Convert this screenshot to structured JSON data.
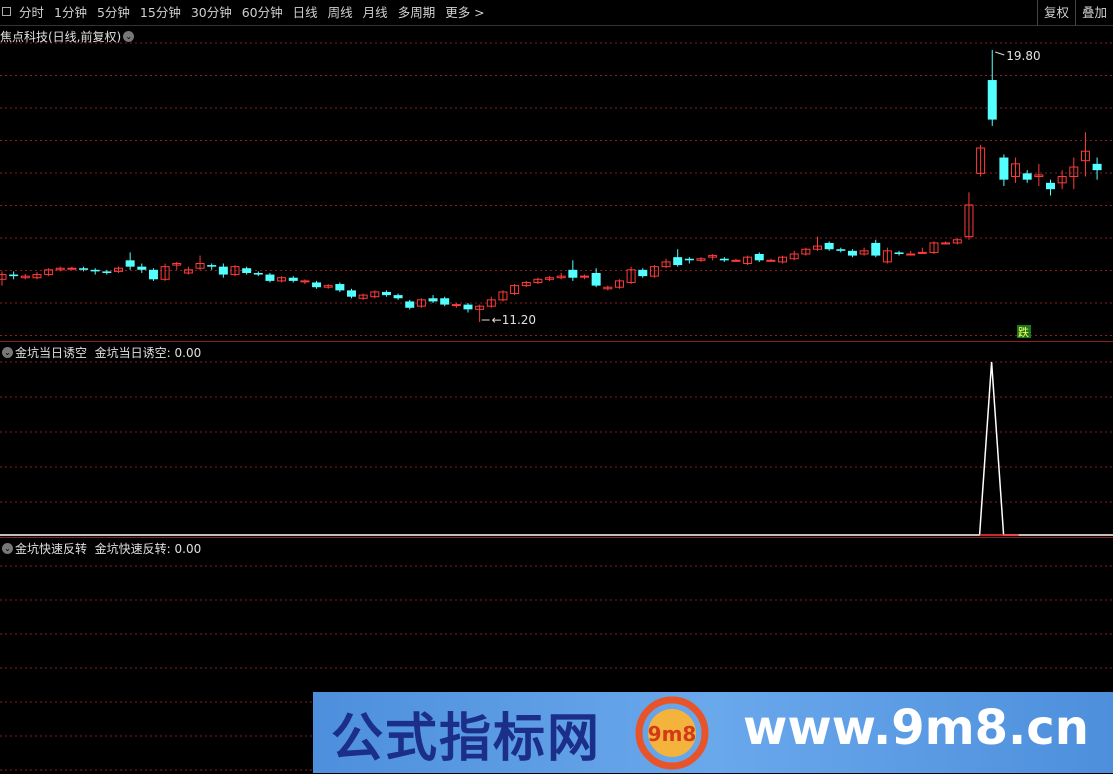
{
  "toolbar": {
    "period_tabs": [
      "分时",
      "1分钟",
      "5分钟",
      "15分钟",
      "30分钟",
      "60分钟",
      "日线",
      "周线",
      "月线",
      "多周期",
      "更多 >"
    ],
    "restore_label": "复权",
    "overlay_label": "叠加"
  },
  "main_chart": {
    "title": "焦点科技(日线,前复权)",
    "high_label": "19.80",
    "low_label": "11.20",
    "badge": "跌",
    "colors": {
      "up": "#ff3b3b",
      "down": "#54ffff",
      "grid": "#8b2020"
    }
  },
  "indicator1": {
    "name": "金坑当日诱空",
    "value_label": "金坑当日诱空: 0.00"
  },
  "indicator2": {
    "name": "金坑快速反转",
    "value_label": "金坑快速反转: 0.00"
  },
  "watermark": {
    "title": "公式指标网",
    "url": "www.9m8.cn",
    "logo_text": "9m8"
  },
  "chart_data": {
    "type": "candlestick",
    "title": "焦点科技(日线,前复权)",
    "candles": [
      [
        12.55,
        12.7,
        12.35,
        12.8
      ],
      [
        12.7,
        12.65,
        12.55,
        12.8
      ],
      [
        12.6,
        12.65,
        12.55,
        12.72
      ],
      [
        12.6,
        12.7,
        12.55,
        12.78
      ],
      [
        12.7,
        12.85,
        12.65,
        12.9
      ],
      [
        12.85,
        12.9,
        12.8,
        12.95
      ],
      [
        12.9,
        12.9,
        12.85,
        12.95
      ],
      [
        12.9,
        12.85,
        12.8,
        12.95
      ],
      [
        12.85,
        12.8,
        12.7,
        12.9
      ],
      [
        12.8,
        12.75,
        12.7,
        12.85
      ],
      [
        12.8,
        12.9,
        12.75,
        12.95
      ],
      [
        13.15,
        12.95,
        12.85,
        13.4
      ],
      [
        12.95,
        12.85,
        12.75,
        13.05
      ],
      [
        12.85,
        12.55,
        12.5,
        12.9
      ],
      [
        12.55,
        12.95,
        12.5,
        13.05
      ],
      [
        13.0,
        13.05,
        12.85,
        13.1
      ],
      [
        12.75,
        12.85,
        12.7,
        12.95
      ],
      [
        12.9,
        13.05,
        12.85,
        13.3
      ],
      [
        13.0,
        12.95,
        12.85,
        13.05
      ],
      [
        12.95,
        12.7,
        12.6,
        13.05
      ],
      [
        12.7,
        12.95,
        12.65,
        13.0
      ],
      [
        12.9,
        12.75,
        12.7,
        12.95
      ],
      [
        12.75,
        12.7,
        12.65,
        12.8
      ],
      [
        12.7,
        12.5,
        12.45,
        12.75
      ],
      [
        12.5,
        12.6,
        12.45,
        12.65
      ],
      [
        12.6,
        12.5,
        12.45,
        12.65
      ],
      [
        12.5,
        12.5,
        12.4,
        12.55
      ],
      [
        12.45,
        12.3,
        12.25,
        12.5
      ],
      [
        12.3,
        12.35,
        12.25,
        12.4
      ],
      [
        12.4,
        12.2,
        12.15,
        12.45
      ],
      [
        12.2,
        12.0,
        11.95,
        12.25
      ],
      [
        11.95,
        12.05,
        11.9,
        12.1
      ],
      [
        12.0,
        12.15,
        11.95,
        12.2
      ],
      [
        12.15,
        12.05,
        12.0,
        12.2
      ],
      [
        12.05,
        11.95,
        11.9,
        12.1
      ],
      [
        11.85,
        11.65,
        11.6,
        11.9
      ],
      [
        11.7,
        11.9,
        11.65,
        11.95
      ],
      [
        11.95,
        11.85,
        11.8,
        12.05
      ],
      [
        11.95,
        11.75,
        11.7,
        12.0
      ],
      [
        11.75,
        11.75,
        11.65,
        11.8
      ],
      [
        11.75,
        11.6,
        11.5,
        11.8
      ],
      [
        11.6,
        11.7,
        11.2,
        11.75
      ],
      [
        11.7,
        11.9,
        11.65,
        12.0
      ],
      [
        11.9,
        12.15,
        11.85,
        12.2
      ],
      [
        12.1,
        12.35,
        12.05,
        12.4
      ],
      [
        12.35,
        12.45,
        12.3,
        12.5
      ],
      [
        12.45,
        12.55,
        12.4,
        12.6
      ],
      [
        12.55,
        12.6,
        12.5,
        12.65
      ],
      [
        12.6,
        12.65,
        12.55,
        12.75
      ],
      [
        12.85,
        12.6,
        12.5,
        13.15
      ],
      [
        12.65,
        12.65,
        12.55,
        12.7
      ],
      [
        12.75,
        12.35,
        12.3,
        12.9
      ],
      [
        12.25,
        12.3,
        12.2,
        12.35
      ],
      [
        12.3,
        12.5,
        12.25,
        12.55
      ],
      [
        12.45,
        12.85,
        12.4,
        12.95
      ],
      [
        12.85,
        12.65,
        12.6,
        12.9
      ],
      [
        12.65,
        12.95,
        12.6,
        13.0
      ],
      [
        12.95,
        13.1,
        12.9,
        13.2
      ],
      [
        13.25,
        13.0,
        12.95,
        13.5
      ],
      [
        13.2,
        13.15,
        13.05,
        13.25
      ],
      [
        13.15,
        13.2,
        13.1,
        13.25
      ],
      [
        13.25,
        13.3,
        13.15,
        13.35
      ],
      [
        13.2,
        13.15,
        13.1,
        13.25
      ],
      [
        13.15,
        13.15,
        13.1,
        13.2
      ],
      [
        13.05,
        13.25,
        13.0,
        13.3
      ],
      [
        13.35,
        13.15,
        13.1,
        13.4
      ],
      [
        13.15,
        13.15,
        13.1,
        13.2
      ],
      [
        13.1,
        13.25,
        13.05,
        13.3
      ],
      [
        13.2,
        13.35,
        13.15,
        13.45
      ],
      [
        13.35,
        13.5,
        13.3,
        13.55
      ],
      [
        13.5,
        13.6,
        13.45,
        13.9
      ],
      [
        13.7,
        13.5,
        13.45,
        13.75
      ],
      [
        13.5,
        13.45,
        13.4,
        13.55
      ],
      [
        13.45,
        13.3,
        13.25,
        13.5
      ],
      [
        13.35,
        13.45,
        13.3,
        13.55
      ],
      [
        13.7,
        13.3,
        13.25,
        13.8
      ],
      [
        13.1,
        13.45,
        13.05,
        13.55
      ],
      [
        13.4,
        13.35,
        13.3,
        13.45
      ],
      [
        13.35,
        13.35,
        13.3,
        13.45
      ],
      [
        13.4,
        13.4,
        13.35,
        13.55
      ],
      [
        13.4,
        13.7,
        13.35,
        13.75
      ],
      [
        13.7,
        13.7,
        13.65,
        13.75
      ],
      [
        13.7,
        13.8,
        13.65,
        13.85
      ],
      [
        13.9,
        14.9,
        13.8,
        15.3
      ],
      [
        15.9,
        16.7,
        15.8,
        16.8
      ],
      [
        18.85,
        17.6,
        17.4,
        19.8
      ],
      [
        16.4,
        15.7,
        15.5,
        16.5
      ],
      [
        15.8,
        16.2,
        15.6,
        16.4
      ],
      [
        15.9,
        15.7,
        15.6,
        16.0
      ],
      [
        15.8,
        15.85,
        15.5,
        16.2
      ],
      [
        15.6,
        15.4,
        15.2,
        15.7
      ],
      [
        15.6,
        15.8,
        15.4,
        16.0
      ],
      [
        15.8,
        16.1,
        15.4,
        16.4
      ],
      [
        16.3,
        16.6,
        15.8,
        17.2
      ],
      [
        16.2,
        16.0,
        15.7,
        16.4
      ]
    ],
    "high_marker": 19.8,
    "low_marker": 11.2,
    "indicators": [
      {
        "name": "金坑当日诱空",
        "current": 0.0,
        "spike_index": 84,
        "spike_value": 1
      },
      {
        "name": "金坑快速反转",
        "current": 0.0
      }
    ]
  }
}
